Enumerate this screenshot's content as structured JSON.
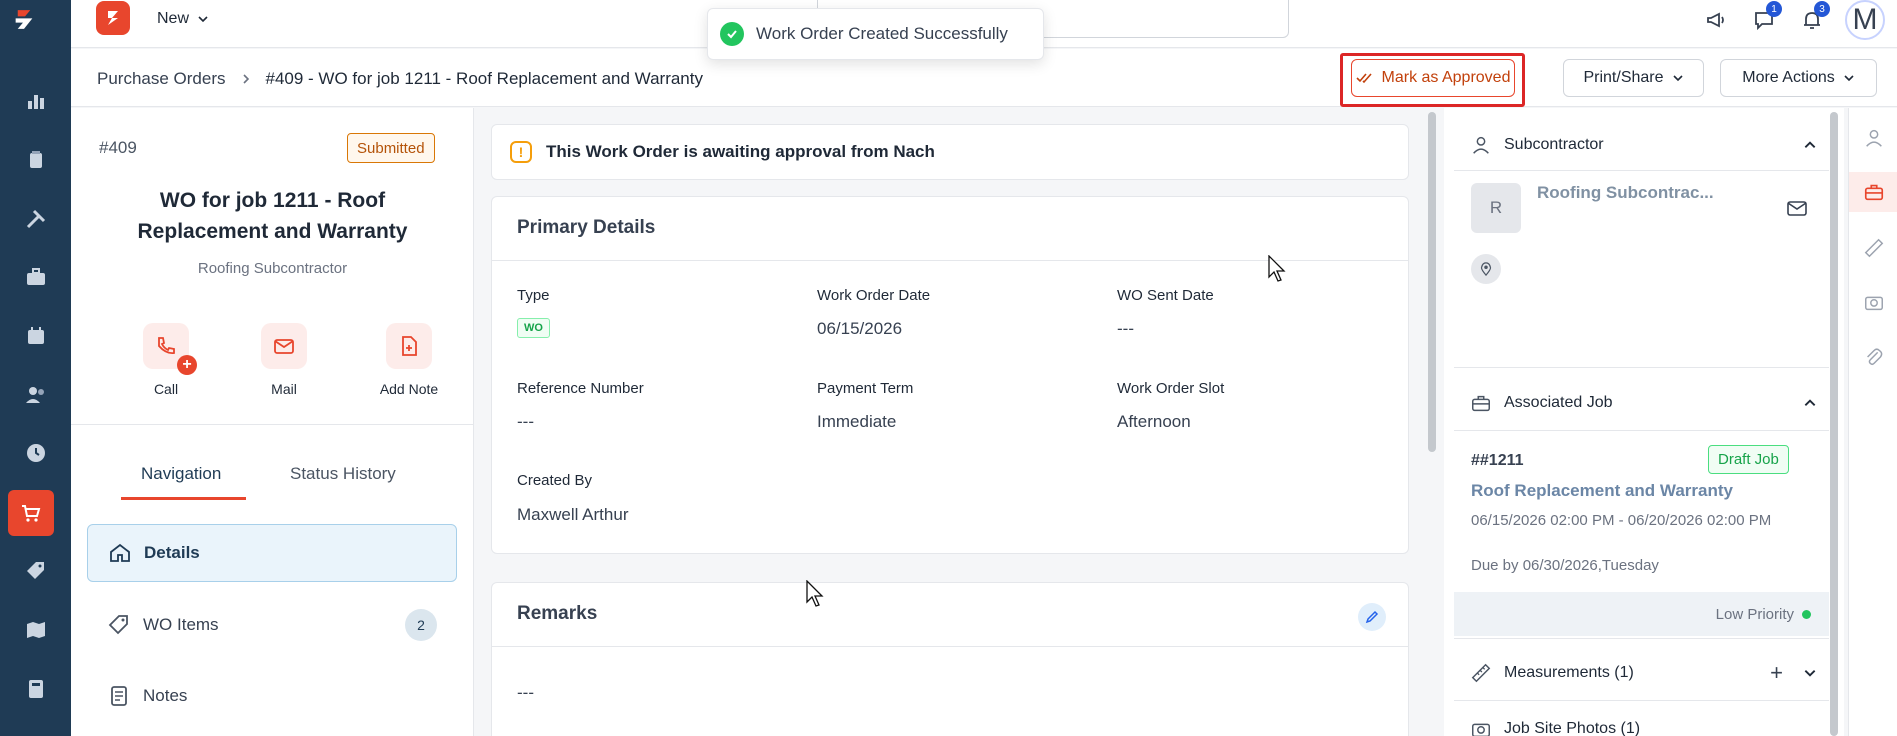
{
  "topbar": {
    "new_label": "New",
    "toast_text": "Work Order Created Successfully",
    "messages_count": "1",
    "notifications_count": "3",
    "avatar_letter": "M"
  },
  "breadcrumb": {
    "parent": "Purchase Orders",
    "current": "#409 - WO for job 1211 - Roof Replacement and Warranty"
  },
  "actions": {
    "approve_label": "Mark as Approved",
    "print_label": "Print/Share",
    "more_label": "More Actions"
  },
  "left_panel": {
    "number": "#409",
    "status": "Submitted",
    "title": "WO for job 1211 - Roof Replacement and Warranty",
    "subtitle": "Roofing Subcontractor",
    "quick_actions": [
      "Call",
      "Mail",
      "Add Note"
    ],
    "tabs": [
      "Navigation",
      "Status History"
    ],
    "nav_items": [
      {
        "label": "Details"
      },
      {
        "label": "WO Items",
        "count": "2"
      },
      {
        "label": "Notes"
      }
    ]
  },
  "alert": {
    "text": "This Work Order is awaiting approval from Nach"
  },
  "primary_details": {
    "heading": "Primary Details",
    "type_label": "Type",
    "type_value": "WO",
    "wo_date_label": "Work Order Date",
    "wo_date_value": "06/15/2026",
    "sent_date_label": "WO Sent Date",
    "sent_date_value": "---",
    "ref_label": "Reference Number",
    "ref_value": "---",
    "payment_label": "Payment Term",
    "payment_value": "Immediate",
    "slot_label": "Work Order Slot",
    "slot_value": "Afternoon",
    "created_label": "Created By",
    "created_value": "Maxwell Arthur"
  },
  "remarks": {
    "heading": "Remarks",
    "value": "---"
  },
  "right_panel": {
    "subcontractor_heading": "Subcontractor",
    "sub_initial": "R",
    "sub_name": "Roofing Subcontrac...",
    "job_heading": "Associated Job",
    "job_number": "##1211",
    "job_status": "Draft Job",
    "job_title": "Roof Replacement and Warranty",
    "job_dates": "06/15/2026 02:00 PM - 06/20/2026 02:00 PM",
    "job_due": "Due by 06/30/2026,Tuesday",
    "priority": "Low Priority",
    "measurements": "Measurements (1)",
    "photos": "Job Site Photos (1)"
  },
  "colors": {
    "brand": "#e8462d",
    "rail": "#1f3b55",
    "highlight": "#dc2626",
    "success": "#22c55e"
  }
}
